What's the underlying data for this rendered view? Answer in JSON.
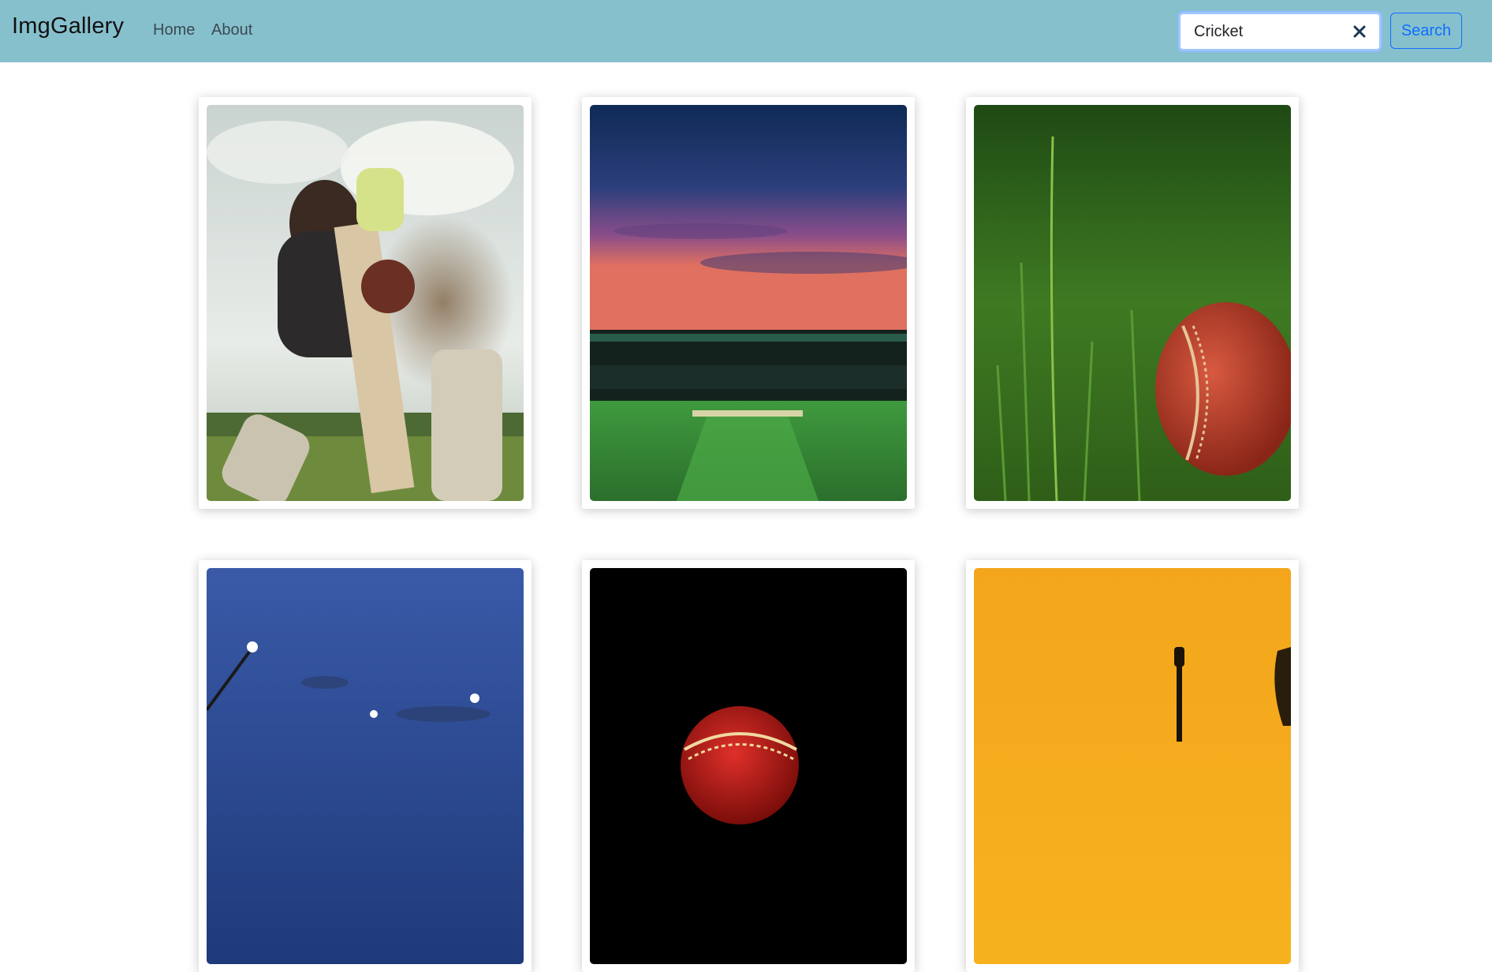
{
  "navbar": {
    "brand": "ImgGallery",
    "links": [
      {
        "label": "Home"
      },
      {
        "label": "About"
      }
    ],
    "background": "#87c0cd"
  },
  "search": {
    "value": "Cricket",
    "button_label": "Search",
    "clear_icon": "close-icon",
    "accent": "#0d6efd"
  },
  "gallery": {
    "images": [
      {
        "subject": "batsman-hitting-ball"
      },
      {
        "subject": "cricket-stadium-at-dusk"
      },
      {
        "subject": "red-ball-in-grass"
      },
      {
        "subject": "floodlights-blue-sky"
      },
      {
        "subject": "red-ball-black-background"
      },
      {
        "subject": "sunset-silhouette-orange"
      }
    ]
  }
}
